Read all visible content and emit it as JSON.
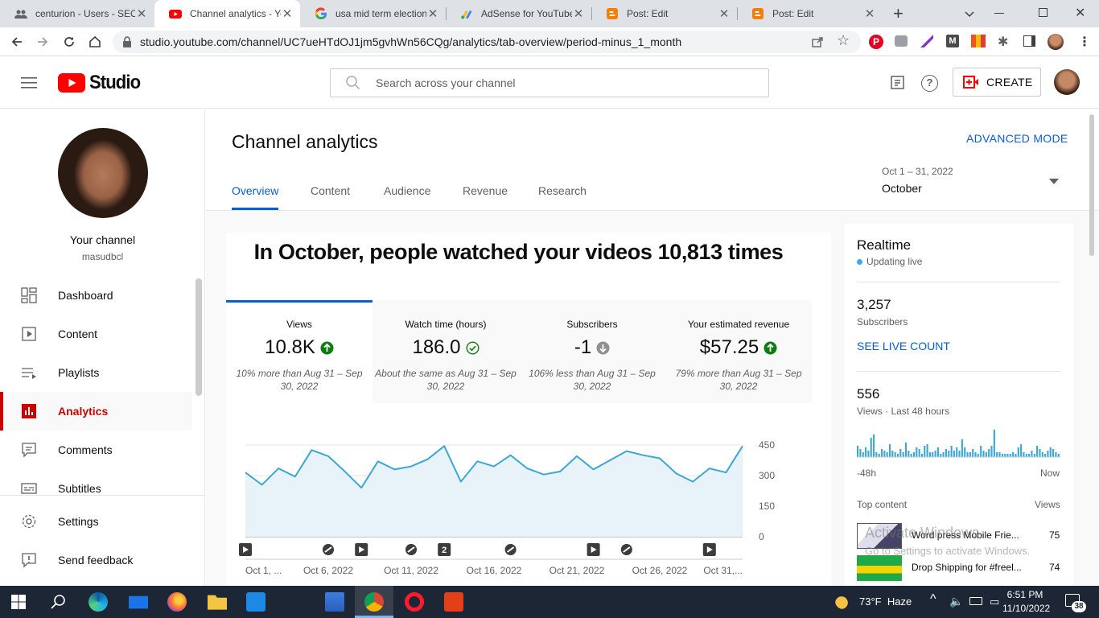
{
  "browser": {
    "tabs": [
      {
        "title": "centurion - Users - SEO",
        "favicon": "users-icon"
      },
      {
        "title": "Channel analytics - YouTube",
        "favicon": "youtube-icon"
      },
      {
        "title": "usa mid term election",
        "favicon": "google-icon"
      },
      {
        "title": "AdSense for YouTube",
        "favicon": "adsense-icon"
      },
      {
        "title": "Post: Edit",
        "favicon": "blogger-icon"
      },
      {
        "title": "Post: Edit",
        "favicon": "blogger-icon"
      }
    ],
    "url": "studio.youtube.com/channel/UC7ueHTdOJ1jm5gvhWn56CQg/analytics/tab-overview/period-minus_1_month"
  },
  "header": {
    "brand": "Studio",
    "search_placeholder": "Search across your channel",
    "create_label": "CREATE"
  },
  "sidebar": {
    "channel_label": "Your channel",
    "channel_handle": "masudbcl",
    "items": [
      {
        "label": "Dashboard",
        "icon": "dashboard-icon"
      },
      {
        "label": "Content",
        "icon": "content-icon"
      },
      {
        "label": "Playlists",
        "icon": "playlists-icon"
      },
      {
        "label": "Analytics",
        "icon": "analytics-icon"
      },
      {
        "label": "Comments",
        "icon": "comments-icon"
      },
      {
        "label": "Subtitles",
        "icon": "subtitles-icon"
      }
    ],
    "settings_label": "Settings",
    "feedback_label": "Send feedback"
  },
  "main": {
    "title": "Channel analytics",
    "advanced_mode": "ADVANCED MODE",
    "tabs": [
      "Overview",
      "Content",
      "Audience",
      "Revenue",
      "Research"
    ],
    "period_range": "Oct 1 – 31, 2022",
    "period_label": "October",
    "headline": "In October, people watched your videos 10,813 times",
    "metrics": [
      {
        "label": "Views",
        "value": "10.8K",
        "status": "up",
        "comparison": "10% more than Aug 31 – Sep 30, 2022"
      },
      {
        "label": "Watch time (hours)",
        "value": "186.0",
        "status": "same",
        "comparison": "About the same as Aug 31 – Sep 30, 2022"
      },
      {
        "label": "Subscribers",
        "value": "-1",
        "status": "down",
        "comparison": "106% less than Aug 31 – Sep 30, 2022"
      },
      {
        "label": "Your estimated revenue",
        "value": "$57.25",
        "status": "up",
        "comparison": "79% more than Aug 31 – Sep 30, 2022"
      }
    ]
  },
  "chart_data": {
    "type": "area",
    "x": [
      1,
      2,
      3,
      4,
      5,
      6,
      7,
      8,
      9,
      10,
      11,
      12,
      13,
      14,
      15,
      16,
      17,
      18,
      19,
      20,
      21,
      22,
      23,
      24,
      25,
      26,
      27,
      28,
      29,
      30,
      31
    ],
    "x_tick_labels": [
      "Oct 1, ...",
      "Oct 6, 2022",
      "Oct 11, 2022",
      "Oct 16, 2022",
      "Oct 21, 2022",
      "Oct 26, 2022",
      "Oct 31,..."
    ],
    "x_tick_positions": [
      1,
      6,
      11,
      16,
      21,
      26,
      31
    ],
    "series": [
      {
        "values": [
          315,
          255,
          335,
          295,
          425,
          395,
          320,
          240,
          370,
          330,
          345,
          380,
          445,
          270,
          370,
          345,
          400,
          335,
          305,
          320,
          395,
          330,
          375,
          420,
          400,
          385,
          310,
          270,
          335,
          315,
          445
        ]
      }
    ],
    "y_ticks": [
      0,
      150,
      300,
      450
    ],
    "ylim": [
      0,
      450
    ],
    "color": "#3ea6d3",
    "fill": "#e8f3f9",
    "markers": [
      {
        "x": 1,
        "icon": "play-icon"
      },
      {
        "x": 6,
        "icon": "link-icon"
      },
      {
        "x": 8,
        "icon": "play-icon"
      },
      {
        "x": 11,
        "icon": "link-icon"
      },
      {
        "x": 13,
        "icon": "count-badge",
        "label": "2"
      },
      {
        "x": 17,
        "icon": "link-icon"
      },
      {
        "x": 22,
        "icon": "play-icon"
      },
      {
        "x": 24,
        "icon": "link-icon"
      },
      {
        "x": 29,
        "icon": "play-icon"
      }
    ]
  },
  "realtime": {
    "title": "Realtime",
    "status": "Updating live",
    "subscribers": "3,257",
    "subscribers_label": "Subscribers",
    "live_count_link": "SEE LIVE COUNT",
    "views": "556",
    "views_label": "Views · Last 48 hours",
    "bars": [
      14,
      10,
      6,
      12,
      8,
      24,
      28,
      6,
      4,
      10,
      8,
      6,
      16,
      8,
      6,
      4,
      10,
      6,
      18,
      8,
      4,
      6,
      12,
      10,
      4,
      14,
      16,
      6,
      6,
      8,
      12,
      4,
      6,
      10,
      8,
      14,
      8,
      12,
      8,
      22,
      12,
      6,
      6,
      10,
      6,
      4,
      14,
      8,
      6,
      10,
      14,
      34,
      6,
      6,
      4,
      4,
      4,
      4,
      6,
      4,
      12,
      16,
      6,
      4,
      4,
      8,
      4,
      14,
      10,
      6,
      4,
      8,
      12,
      10,
      6,
      4
    ],
    "range_start": "-48h",
    "range_end": "Now",
    "top_content_label": "Top content",
    "top_content_col": "Views",
    "top_items": [
      {
        "title": "Word press Mobile Frie...",
        "views": "75"
      },
      {
        "title": "Drop Shipping for #freel...",
        "views": "74"
      }
    ]
  },
  "watermark": {
    "line1": "Activate Windows",
    "line2": "Go to Settings to activate Windows."
  },
  "taskbar": {
    "weather": "73°F  Haze",
    "time": "6:51 PM",
    "date": "11/10/2022",
    "notifications": "38"
  },
  "colors": {
    "accent": "#065fd4",
    "brand_red": "#ff0000",
    "selected_nav": "#cc0000",
    "up_green": "#0f7c0f"
  }
}
